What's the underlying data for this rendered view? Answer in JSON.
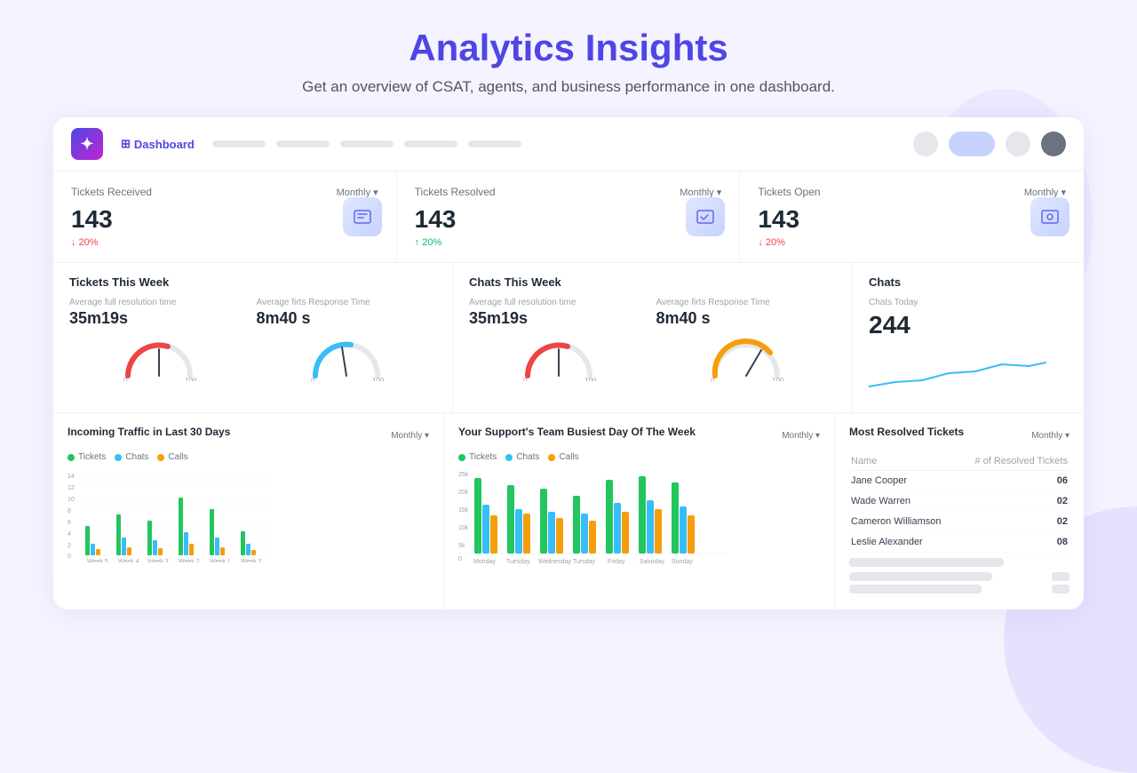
{
  "page": {
    "title": "Analytics Insights",
    "subtitle": "Get an overview of CSAT, agents, and business performance in one dashboard."
  },
  "nav": {
    "dashboard_label": "Dashboard",
    "items": [
      "",
      "",
      "",
      "",
      ""
    ]
  },
  "metrics": [
    {
      "label": "Tickets Received",
      "filter": "Monthly ▾",
      "value": "143",
      "change": "↓ 20%",
      "direction": "down"
    },
    {
      "label": "Tickets Resolved",
      "filter": "Monthly ▾",
      "value": "143",
      "change": "↑ 20%",
      "direction": "up"
    },
    {
      "label": "Tickets Open",
      "filter": "Monthly ▾",
      "value": "143",
      "change": "↓ 20%",
      "direction": "down"
    }
  ],
  "tickets_week": {
    "title": "Tickets This Week",
    "avg_resolution_label": "Average full resolution time",
    "avg_resolution_value": "35m19s",
    "avg_first_label": "Average firts Response Time",
    "avg_first_value": "8m40 s"
  },
  "chats_week": {
    "title": "Chats This Week",
    "avg_resolution_label": "Average full resolution time",
    "avg_resolution_value": "35m19s",
    "avg_first_label": "Average firts Response Time",
    "avg_first_value": "8m40 s"
  },
  "chats": {
    "title": "Chats",
    "today_label": "Chats Today",
    "today_value": "244"
  },
  "incoming_traffic": {
    "title": "Incoming Traffic in Last 30 Days",
    "filter": "Monthly ▾",
    "legend": [
      {
        "label": "Tickets",
        "color": "#22c55e"
      },
      {
        "label": "Chats",
        "color": "#38bdf8"
      },
      {
        "label": "Calls",
        "color": "#f59e0b"
      }
    ],
    "x_labels": [
      "Week 5",
      "Week 4",
      "Week 3",
      "Week 2",
      "Week 1",
      "Week 2"
    ],
    "y_labels": [
      "14",
      "12",
      "10",
      "8",
      "6",
      "4",
      "2",
      "0"
    ]
  },
  "busiest_day": {
    "title": "Your Support's Team Busiest Day Of The Week",
    "filter": "Monthly ▾",
    "legend": [
      {
        "label": "Tickets",
        "color": "#22c55e"
      },
      {
        "label": "Chats",
        "color": "#38bdf8"
      },
      {
        "label": "Calls",
        "color": "#f59e0b"
      }
    ],
    "days": [
      "Monday",
      "Tuesday",
      "Wednesday",
      "Tursday",
      "Friday",
      "Saturday",
      "Sunday"
    ]
  },
  "most_resolved": {
    "title": "Most Resolved Tickets",
    "filter": "Monthly ▾",
    "col_name": "Name",
    "col_tickets": "# of Resolved Tickets",
    "rows": [
      {
        "name": "Jane Cooper",
        "count": "06"
      },
      {
        "name": "Wade Warren",
        "count": "02"
      },
      {
        "name": "Cameron Williamson",
        "count": "02"
      },
      {
        "name": "Leslie Alexander",
        "count": "08"
      }
    ]
  },
  "colors": {
    "primary": "#4f46e5",
    "green": "#22c55e",
    "blue": "#38bdf8",
    "amber": "#f59e0b",
    "red": "#ef4444",
    "gauge_red": "#ef4444",
    "gauge_blue": "#38bdf8",
    "gauge_track": "#e5e7eb"
  }
}
